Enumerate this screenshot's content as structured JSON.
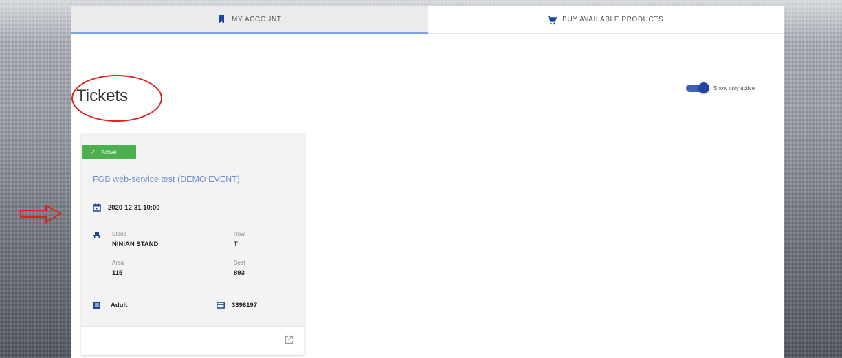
{
  "tabs": [
    {
      "label": "MY ACCOUNT",
      "icon": "bookmark-icon"
    },
    {
      "label": "BUY AVAILABLE PRODUCTS",
      "icon": "cart-icon"
    }
  ],
  "page": {
    "title": "Tickets",
    "toggle_label": "Show only active"
  },
  "ticket": {
    "status": "Active",
    "event_name": "FGB web-service test (DEMO EVENT)",
    "datetime": "2020-12-31 10:00",
    "stand_label": "Stand",
    "stand_value": "NINIAN STAND",
    "row_label": "Row",
    "row_value": "T",
    "area_label": "Area",
    "area_value": "115",
    "seat_label": "Seat",
    "seat_value": "893",
    "ticket_type": "Adult",
    "ticket_number": "3396197"
  },
  "colors": {
    "accent": "#3b63b8",
    "active_badge": "#4caf50",
    "link": "#6f8fd0",
    "annotation": "#d9241f"
  }
}
